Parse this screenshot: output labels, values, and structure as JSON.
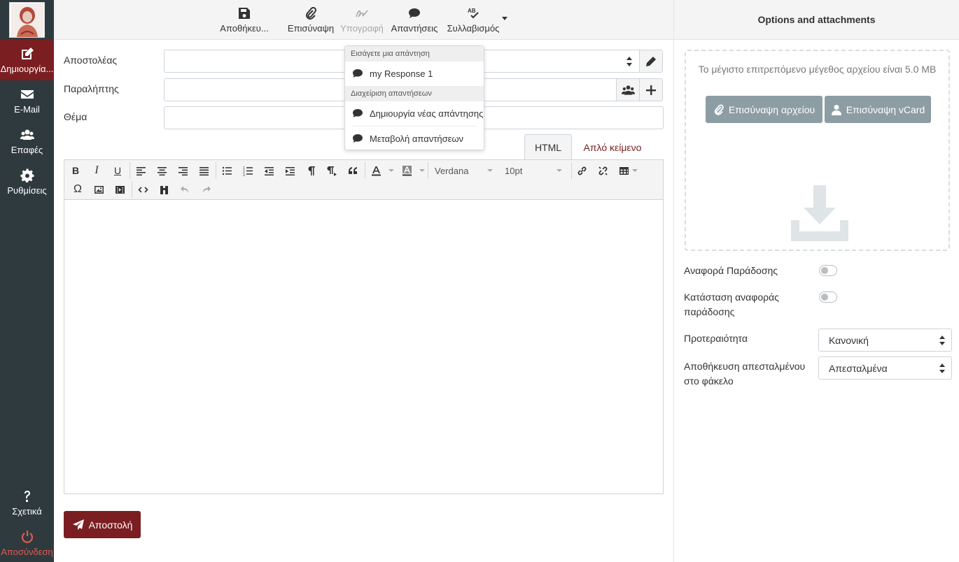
{
  "sidebar": {
    "logo_alt": "logo",
    "items": [
      {
        "label": "Δημιουργία...",
        "icon": "edit-icon",
        "active": true
      },
      {
        "label": "E-Mail",
        "icon": "envelope-icon"
      },
      {
        "label": "Επαφές",
        "icon": "users-icon"
      },
      {
        "label": "Ρυθμίσεις",
        "icon": "gear-icon"
      }
    ],
    "about_label": "Σχετικά",
    "logout_label": "Αποσύνδεση"
  },
  "toolbar": {
    "save_label": "Αποθήκευ...",
    "attach_label": "Επισύναψη",
    "signature_label": "Υπογραφή",
    "responses_label": "Απαντήσεις",
    "spell_label": "Συλλαβισμός"
  },
  "responses_menu": {
    "insert_header": "Εισάγετε μια απάντηση",
    "response_1": "my Response 1",
    "manage_header": "Διαχείριση απαντήσεων",
    "create_label": "Δημιουργία νέας απάντησης",
    "edit_label": "Μεταβολή απαντήσεων"
  },
  "form": {
    "from_label": "Αποστολέας",
    "to_label": "Παραλήπτης",
    "subject_label": "Θέμα",
    "from_value": "",
    "to_value": "",
    "subject_value": ""
  },
  "tabs": {
    "html_label": "HTML",
    "plain_label": "Απλό κείμενο"
  },
  "editor": {
    "font_family": "Verdana",
    "font_size": "10pt",
    "body": ""
  },
  "send_label": "Αποστολή",
  "right": {
    "title": "Options and attachments",
    "max_size_text": "Το μέγιστο επιτρεπόμενο μέγεθος αρχείου είναι 5.0 MB",
    "attach_file_label": "Επισύναψη αρχείου",
    "attach_vcard_label": "Επισύναψη vCard",
    "delivery_report_label": "Αναφορά Παράδοσης",
    "delivery_status_label": "Κατάσταση αναφοράς παράδοσης",
    "priority_label": "Προτεραιότητα",
    "priority_value": "Κανονική",
    "save_sent_label": "Αποθήκευση απεσταλμένου στο φάκελο",
    "save_sent_value": "Απεσταλμένα"
  },
  "colors": {
    "sidebar_bg": "#2f3a3f",
    "accent": "#7a1e21",
    "attach_btn": "#8c9ea3",
    "logout": "#e05a4f"
  }
}
